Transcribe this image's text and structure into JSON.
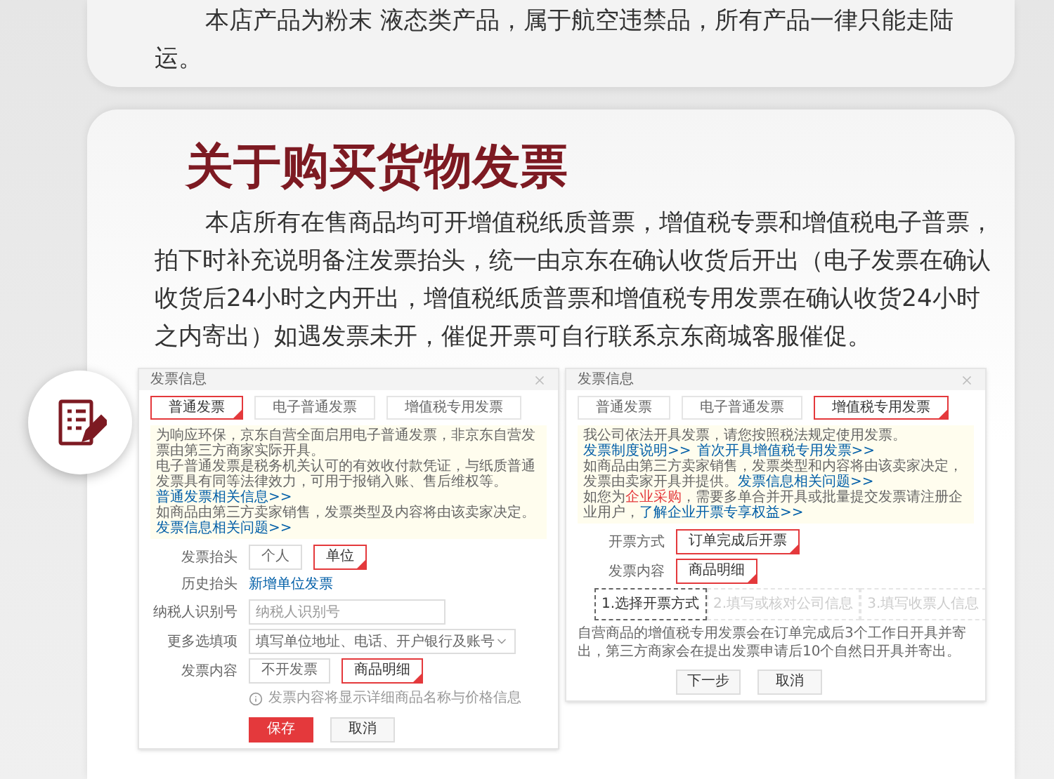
{
  "top_notice": {
    "text": "本店产品为粉末 液态类产品，属于航空违禁品，所有产品一律只能走陆运。"
  },
  "section": {
    "title": "关于购买货物发票",
    "body": "本店所有在售商品均可开增值税纸质普票，增值税专票和增值税电子普票，拍下时补充说明备注发票抬头，统一由京东在确认收货后开出（电子发票在确认收货后24小时之内开出，增值税纸质普票和增值税专用发票在确认收货24小时之内寄出）如遇发票未开，催促开票可自行联系京东商城客服催促。"
  },
  "dialogs": [
    {
      "title": "发票信息",
      "tabs": [
        {
          "label": "普通发票",
          "selected": true
        },
        {
          "label": "电子普通发票",
          "selected": false
        },
        {
          "label": "增值税专用发票",
          "selected": false
        }
      ],
      "notice": [
        [
          {
            "kind": "text",
            "text": "为响应环保，京东自营全面启用电子普通发票，非京东自营发票由第三方商家实际开具。"
          }
        ],
        [
          {
            "kind": "text",
            "text": "电子普通发票是税务机关认可的有效收付款凭证，与纸质普通发票具有同等法律效力，可用于报销入账、售后维权等。"
          },
          {
            "kind": "link",
            "text": "普通发票相关信息>>"
          }
        ],
        [
          {
            "kind": "text",
            "text": "如商品由第三方卖家销售，发票类型及内容将由该卖家决定。"
          },
          {
            "kind": "link",
            "text": "发票信息相关问题>>"
          }
        ]
      ],
      "fields": [
        {
          "kind": "options",
          "label": "发票抬头",
          "options": [
            {
              "label": "个人",
              "selected": false
            },
            {
              "label": "单位",
              "selected": true
            }
          ]
        },
        {
          "kind": "link",
          "label": "历史抬头",
          "link": "新增单位发票"
        },
        {
          "kind": "input",
          "label": "纳税人识别号",
          "placeholder": "纳税人识别号"
        },
        {
          "kind": "select",
          "label": "更多选填项",
          "value": "填写单位地址、电话、开户银行及账号"
        },
        {
          "kind": "options",
          "label": "发票内容",
          "options": [
            {
              "label": "不开发票",
              "selected": false
            },
            {
              "label": "商品明细",
              "selected": true
            }
          ]
        },
        {
          "kind": "hint",
          "text": "发票内容将显示详细商品名称与价格信息"
        }
      ],
      "buttons": [
        {
          "label": "保存",
          "primary": true
        },
        {
          "label": "取消",
          "primary": false
        }
      ]
    },
    {
      "title": "发票信息",
      "tabs": [
        {
          "label": "普通发票",
          "selected": false
        },
        {
          "label": "电子普通发票",
          "selected": false
        },
        {
          "label": "增值税专用发票",
          "selected": true
        }
      ],
      "notice": [
        [
          {
            "kind": "text",
            "text": "我公司依法开具发票，请您按照税法规定使用发票。"
          }
        ],
        [
          {
            "kind": "link",
            "text": "发票制度说明>>"
          },
          {
            "kind": "link",
            "text": "首次开具增值税专用发票>>"
          }
        ],
        [
          {
            "kind": "text",
            "text": "如商品由第三方卖家销售，发票类型和内容将由该卖家决定，发票由卖家开具并提供。"
          },
          {
            "kind": "link",
            "text": "发票信息相关问题>>"
          }
        ],
        [
          {
            "kind": "text",
            "text": "如您为"
          },
          {
            "kind": "alert",
            "text": "企业采购"
          },
          {
            "kind": "text",
            "text": "，需要多单合并开具或批量提交发票请注册企业用户，"
          },
          {
            "kind": "link",
            "text": "了解企业开票专享权益>>"
          }
        ]
      ],
      "fields": [
        {
          "kind": "options",
          "label": "开票方式",
          "options": [
            {
              "label": "订单完成后开票",
              "selected": true
            }
          ]
        },
        {
          "kind": "options",
          "label": "发票内容",
          "options": [
            {
              "label": "商品明细",
              "selected": true
            }
          ]
        },
        {
          "kind": "steps",
          "steps": [
            {
              "label": "1.选择开票方式",
              "selected": true
            },
            {
              "label": "2.填写或核对公司信息",
              "selected": false
            },
            {
              "label": "3.填写收票人信息",
              "selected": false
            }
          ]
        },
        {
          "kind": "text",
          "text": "自营商品的增值税专用发票会在订单完成后3个工作日开具并寄出，第三方商家会在提出发票申请后10个自然日开具并寄出。"
        }
      ],
      "buttons": [
        {
          "label": "下一步",
          "primary": false
        },
        {
          "label": "取消",
          "primary": false
        }
      ]
    }
  ]
}
